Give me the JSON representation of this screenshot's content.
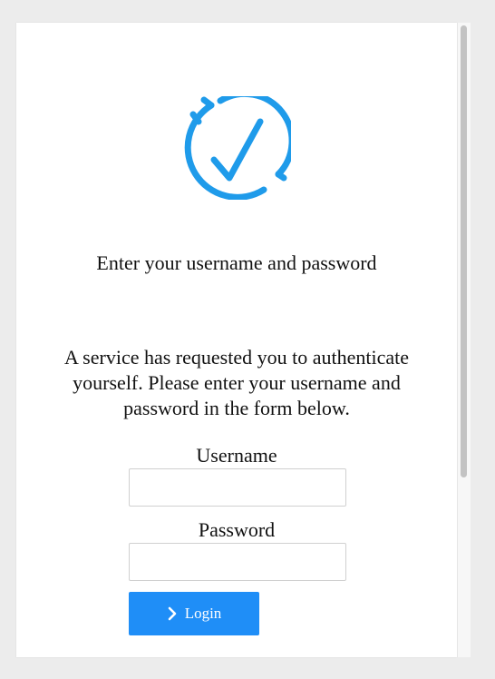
{
  "header": {
    "logo_icon": "checkmark-circle-icon",
    "brand_color": "#1f9bea"
  },
  "main": {
    "heading": "Enter your username and password",
    "description": "A service has requested you to authenticate yourself. Please enter your username and password in the form below."
  },
  "form": {
    "username_label": "Username",
    "username_value": "",
    "password_label": "Password",
    "password_value": "",
    "login_label": "Login",
    "login_icon": "chevron-right-icon",
    "button_color": "#1f8ef7"
  }
}
